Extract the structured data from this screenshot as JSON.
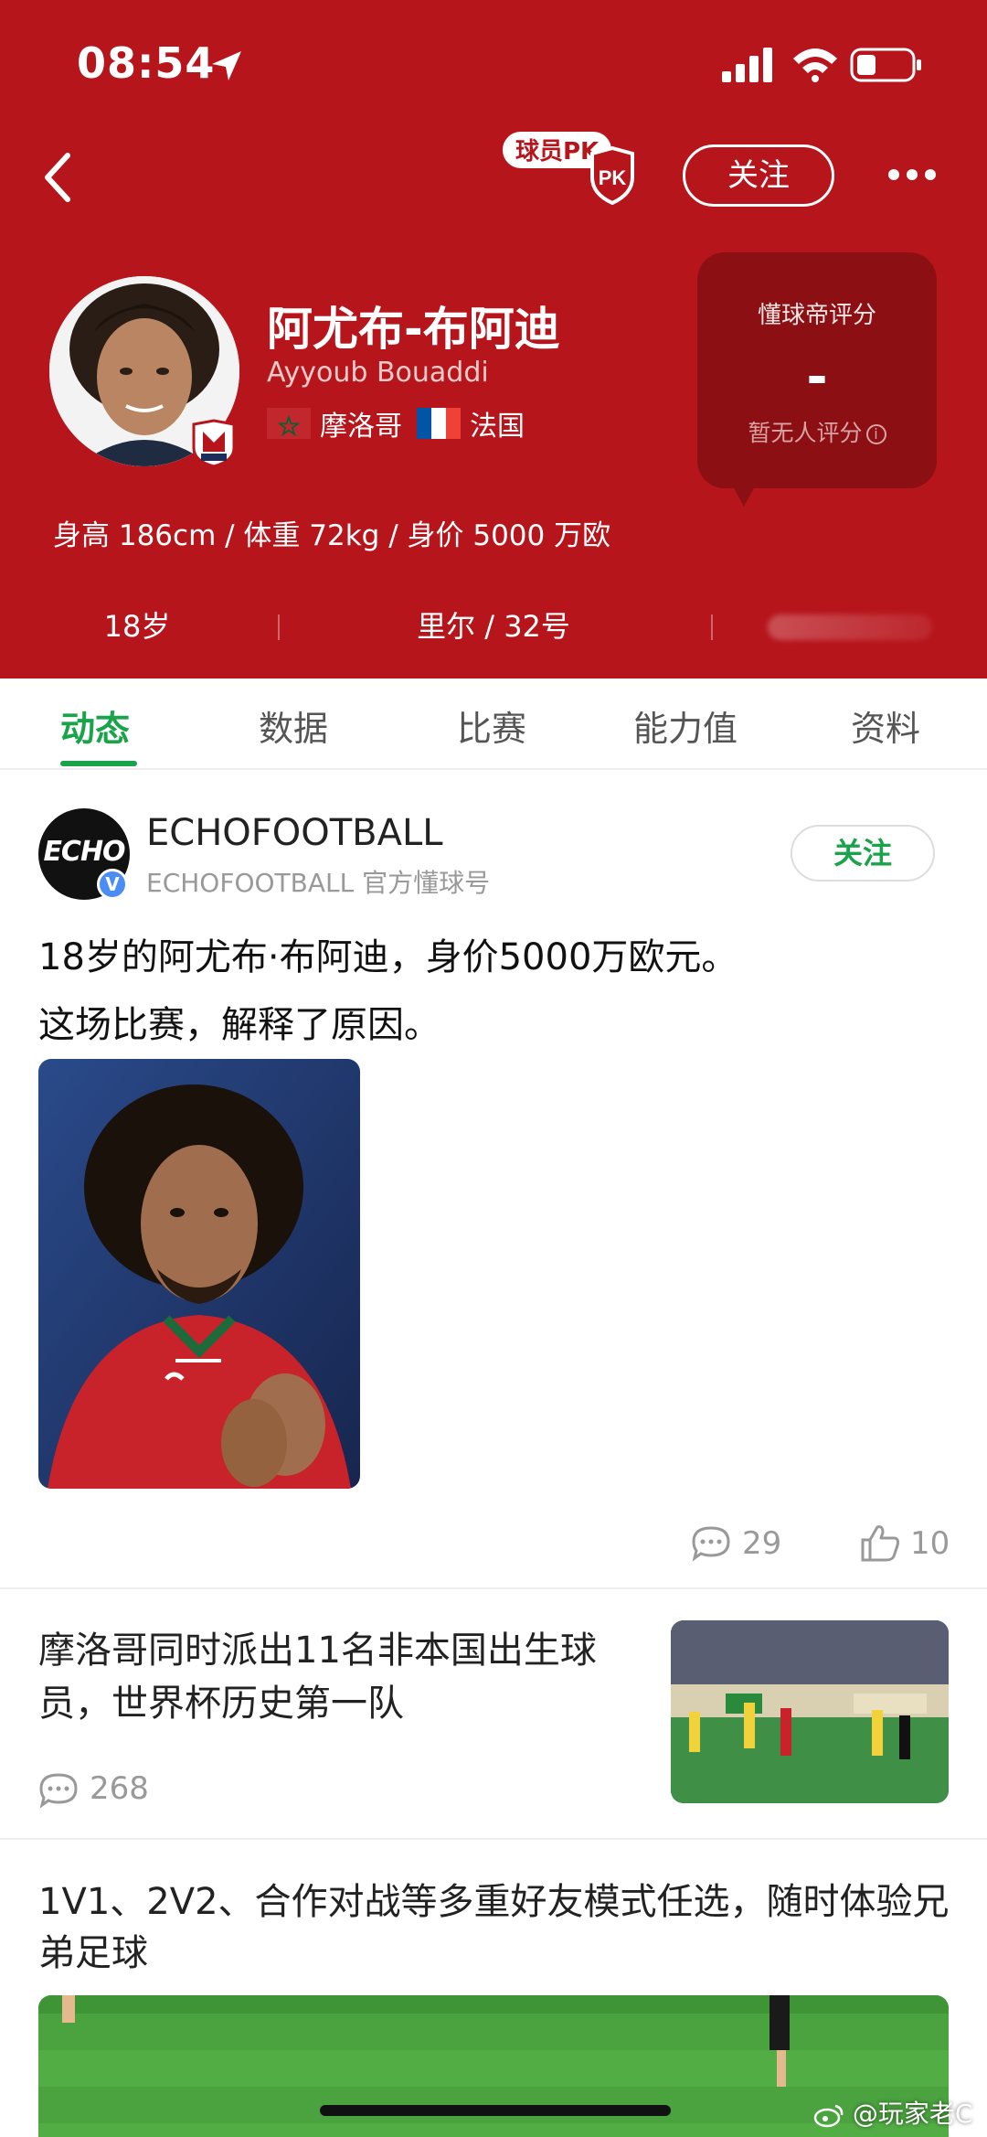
{
  "status_bar": {
    "time": "08:54"
  },
  "topbar": {
    "pk_label": "球员PK",
    "pk_shield": "PK",
    "follow_label": "关注"
  },
  "player": {
    "name_cn": "阿尤布-布阿迪",
    "name_en": "Ayyoub Bouaddi",
    "nations": [
      "摩洛哥",
      "法国"
    ],
    "stats": "身高 186cm / 体重 72kg / 身价 5000 万欧",
    "age": "18岁",
    "club_number": "里尔 / 32号"
  },
  "rating": {
    "title": "懂球帝评分",
    "value": "-",
    "subtitle": "暂无人评分"
  },
  "tabs": [
    {
      "label": "动态",
      "active": true
    },
    {
      "label": "数据",
      "active": false
    },
    {
      "label": "比赛",
      "active": false
    },
    {
      "label": "能力值",
      "active": false
    },
    {
      "label": "资料",
      "active": false
    }
  ],
  "post": {
    "author": "ECHOFOOTBALL",
    "author_sub": "ECHOFOOTBALL 官方懂球号",
    "avatar_text": "ECHO",
    "follow_label": "关注",
    "text_line1": "18岁的阿尤布·布阿迪，身价5000万欧元。",
    "text_line2": "这场比赛，解释了原因。",
    "comments": "29",
    "likes": "10"
  },
  "news": [
    {
      "title": "摩洛哥同时派出11名非本国出生球员，世界杯历史第一队",
      "comments": "268"
    },
    {
      "title": "1V1、2V2、合作对战等多重好友模式任选，随时体验兄弟足球"
    }
  ],
  "watermark": "@玩家老C",
  "colors": {
    "header": "#b7151c",
    "accent": "#1aa34a",
    "rating_box": "#8c0f13"
  }
}
